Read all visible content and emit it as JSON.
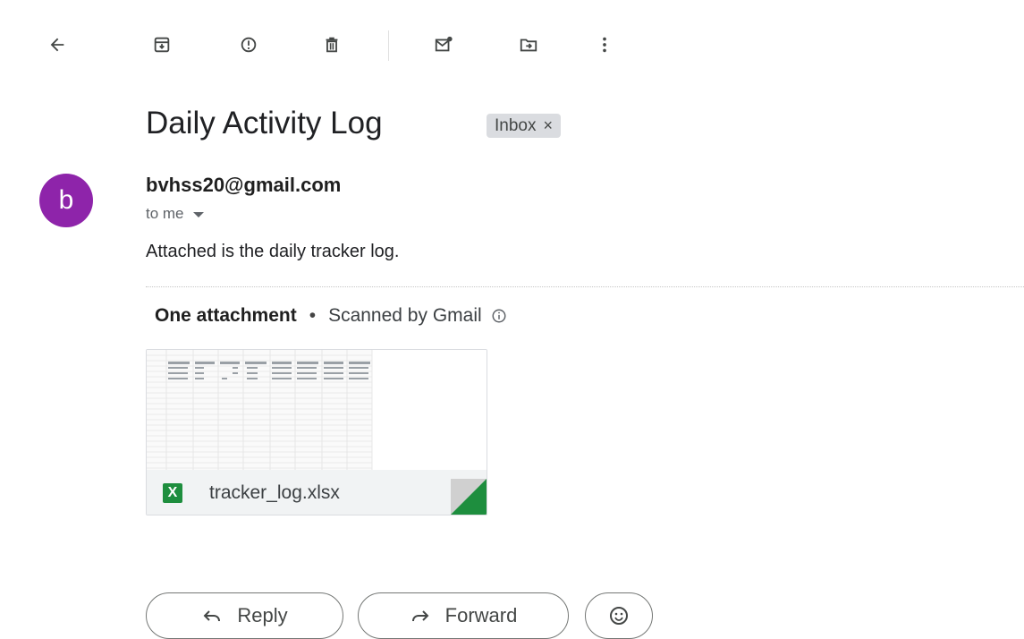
{
  "toolbar": {
    "icons": [
      "back-arrow-icon",
      "archive-icon",
      "report-spam-icon",
      "delete-icon",
      "mark-unread-icon",
      "move-to-icon",
      "more-vert-icon"
    ]
  },
  "email": {
    "subject": "Daily Activity Log",
    "label": "Inbox",
    "label_close": "×",
    "avatar_letter": "b",
    "sender": "bvhss20@gmail.com",
    "recipient": "to me",
    "body": "Attached is the daily tracker log."
  },
  "attachments": {
    "count_label": "One attachment",
    "separator": "•",
    "scan_label": "Scanned by Gmail",
    "file_name": "tracker_log.xlsx",
    "file_badge": "X",
    "accent_color": "#1e8e3e"
  },
  "actions": {
    "reply_label": "Reply",
    "forward_label": "Forward"
  },
  "colors": {
    "avatar": "#8e24aa",
    "excel": "#1e8e3e"
  }
}
